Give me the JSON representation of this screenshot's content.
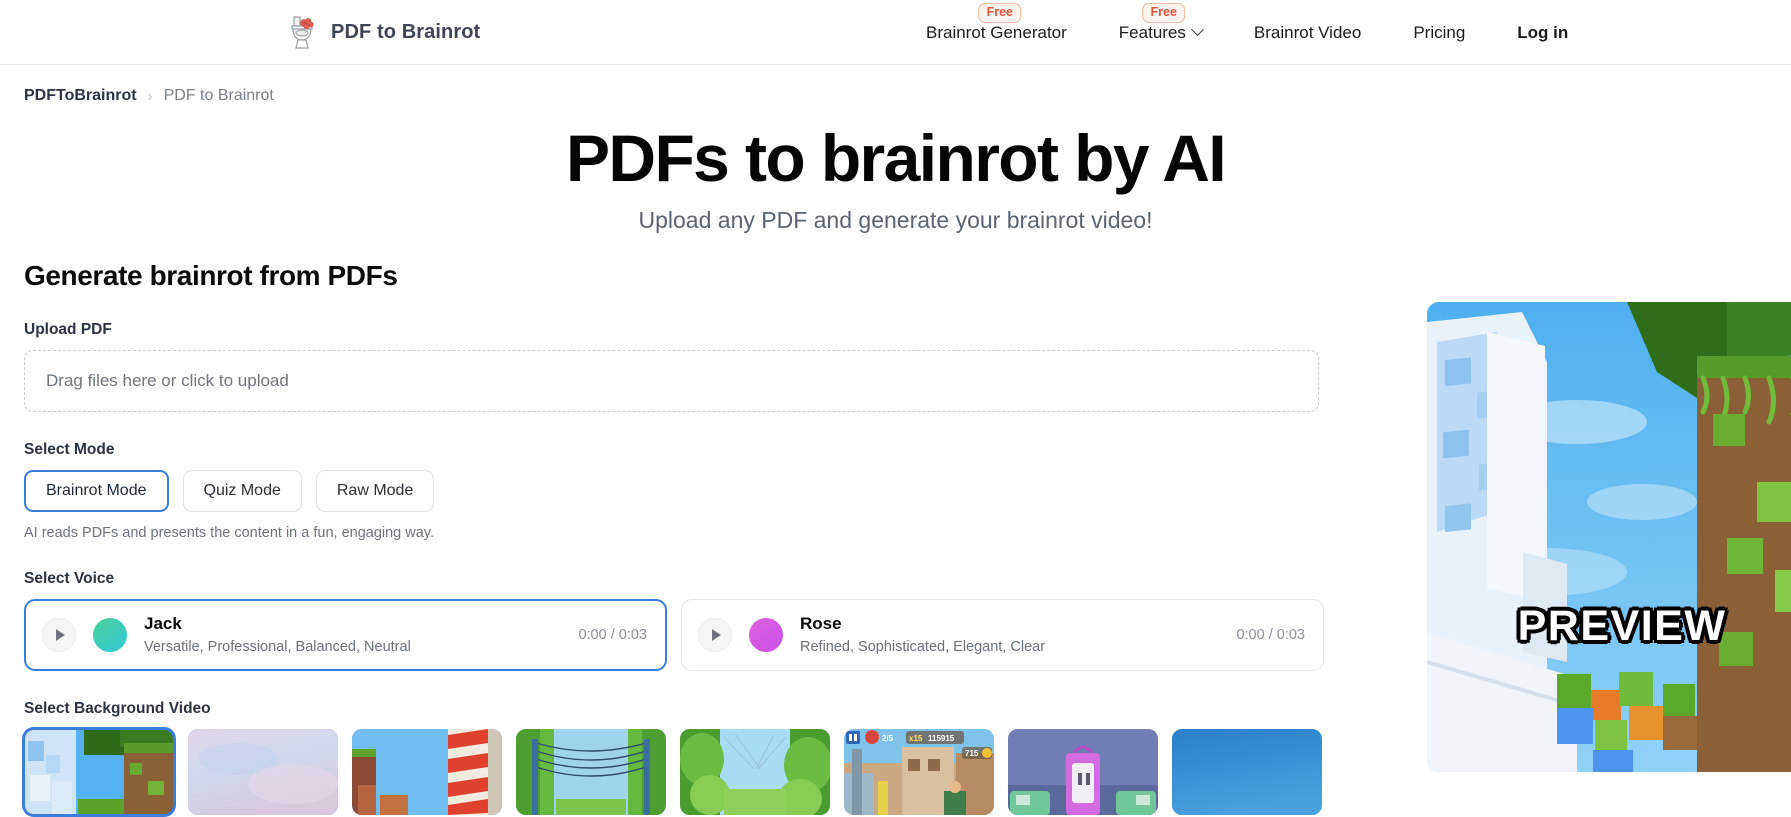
{
  "header": {
    "brand": "PDF to Brainrot",
    "logo_icon": "toilet-brainrot-icon",
    "nav": [
      {
        "label": "Brainrot Generator",
        "badge": "Free",
        "bold": false,
        "chevron": false
      },
      {
        "label": "Features",
        "badge": "Free",
        "bold": false,
        "chevron": true
      },
      {
        "label": "Brainrot Video",
        "badge": "",
        "bold": false,
        "chevron": false
      },
      {
        "label": "Pricing",
        "badge": "",
        "bold": false,
        "chevron": false
      },
      {
        "label": "Log in",
        "badge": "",
        "bold": true,
        "chevron": false
      }
    ]
  },
  "breadcrumb": {
    "home": "PDFToBrainrot",
    "separator": "›",
    "current": "PDF to Brainrot"
  },
  "hero": {
    "title": "PDFs to brainrot by AI",
    "subtitle": "Upload any PDF and generate your brainrot video!"
  },
  "form": {
    "section_title": "Generate brainrot from PDFs",
    "upload": {
      "label": "Upload PDF",
      "placeholder": "Drag files here or click to upload"
    },
    "mode": {
      "label": "Select Mode",
      "options": [
        {
          "label": "Brainrot Mode",
          "selected": true
        },
        {
          "label": "Quiz Mode",
          "selected": false
        },
        {
          "label": "Raw Mode",
          "selected": false
        }
      ],
      "hint": "AI reads PDFs and presents the content in a fun, engaging way."
    },
    "voice": {
      "label": "Select Voice",
      "options": [
        {
          "name": "Jack",
          "description": "Versatile, Professional, Balanced, Neutral",
          "time": "0:00 / 0:03",
          "selected": true,
          "avatar_color": "#2ec8d6"
        },
        {
          "name": "Rose",
          "description": "Refined, Sophisticated, Elegant, Clear",
          "time": "0:00 / 0:03",
          "selected": false,
          "avatar_color": "#d45ae4"
        }
      ]
    },
    "background": {
      "label": "Select Background Video",
      "thumbnails": [
        {
          "name": "minecraft-ice-village",
          "selected": true
        },
        {
          "name": "pink-sky-clouds",
          "selected": false
        },
        {
          "name": "minecraft-red-white-tower",
          "selected": false
        },
        {
          "name": "green-parkour-wires",
          "selected": false
        },
        {
          "name": "green-parkour-tunnel",
          "selected": false
        },
        {
          "name": "subway-surfers-city",
          "selected": false
        },
        {
          "name": "subway-surfers-train-night",
          "selected": false
        },
        {
          "name": "blue-gradient-blank",
          "selected": false
        }
      ]
    }
  },
  "preview": {
    "label": "PREVIEW",
    "scene": "minecraft-ice-and-grass"
  },
  "colors": {
    "accent": "#3b7ddd",
    "badge_text": "#e0533d",
    "badge_bg": "#fdf3ee",
    "badge_border": "#f0b9a4",
    "muted_text": "#6b7380"
  },
  "hud": {
    "subway_multiplier": "x15",
    "subway_score": "115915",
    "subway_coins": "715",
    "subway_progress": "2/5"
  }
}
